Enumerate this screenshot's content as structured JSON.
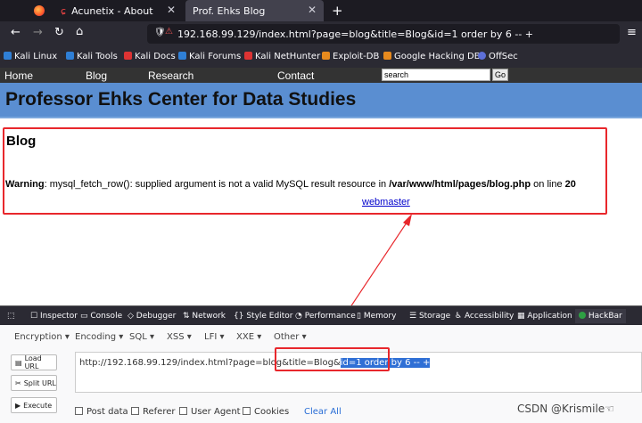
{
  "browser": {
    "tabs": [
      {
        "label": "Acunetix - About"
      },
      {
        "label": "Prof. Ehks Blog"
      }
    ],
    "url": "192.168.99.129/index.html?page=blog&title=Blog&id=1 order by 6 -- +",
    "bookmarks": [
      "Kali Linux",
      "Kali Tools",
      "Kali Docs",
      "Kali Forums",
      "Kali NetHunter",
      "Exploit-DB",
      "Google Hacking DB",
      "OffSec"
    ]
  },
  "site": {
    "nav": [
      "Home",
      "Blog",
      "Research",
      "Contact"
    ],
    "search_value": "search",
    "go_label": "Go",
    "header": "Professor Ehks Center for Data Studies",
    "section_title": "Blog",
    "warning_label": "Warning",
    "warning_text": ": mysql_fetch_row(): supplied argument is not a valid MySQL result resource in ",
    "warning_path": "/var/www/html/pages/blog.php",
    "warning_on_line": " on line ",
    "warning_line": "20",
    "webmaster": "webmaster"
  },
  "devtools": {
    "tabs": [
      "Inspector",
      "Console",
      "Debugger",
      "Network",
      "Style Editor",
      "Performance",
      "Memory",
      "Storage",
      "Accessibility",
      "Application",
      "HackBar"
    ]
  },
  "hackbar": {
    "menus": [
      "Encryption",
      "Encoding",
      "SQL",
      "XSS",
      "LFI",
      "XXE",
      "Other"
    ],
    "buttons": [
      "Load URL",
      "Split URL",
      "Execute"
    ],
    "url_prefix": "http://192.168.99.129/index.html?page=blog&title=Blog&",
    "url_selected": "id=1 order by 6 -- +",
    "options": [
      "Post data",
      "Referer",
      "User Agent",
      "Cookies"
    ],
    "clear_all": "Clear All"
  },
  "watermark": "CSDN @Krismile☜",
  "colors": {
    "annotation": "#e8272c",
    "banner": "#5a8ed1"
  }
}
